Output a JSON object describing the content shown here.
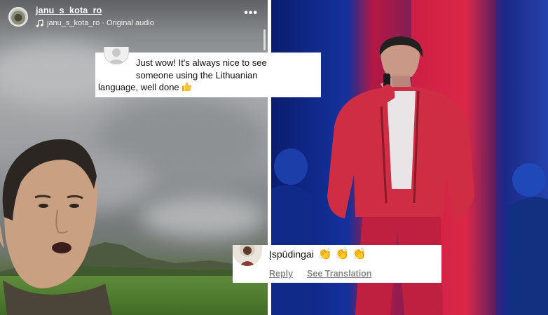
{
  "header": {
    "username": "janu_s_kota_ro",
    "audio_label": "janu_s_kota_ro · Original audio",
    "more_icon": "more-horizontal-icon"
  },
  "comments": {
    "top": {
      "text_line1": "Just wow! It's always nice to see",
      "text_line2": "someone using the Lithuanian",
      "text_line3": "language, well done",
      "emoji": "thumbs-up"
    },
    "bottom": {
      "text": "Įspūdingai",
      "claps": "👏 👏 👏",
      "reply_label": "Reply",
      "translate_label": "See Translation"
    }
  },
  "colors": {
    "stage_blue": "#14309a",
    "stage_red": "#e0203a",
    "jacket_red": "#c8283c",
    "comment_action": "#8a8a8a"
  }
}
